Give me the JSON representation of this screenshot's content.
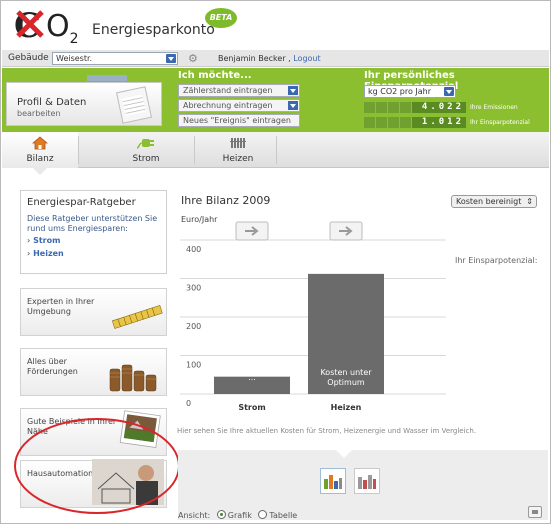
{
  "logo": {
    "brand_text": "Energiesparkonto",
    "badge": "BETA"
  },
  "topbar": {
    "gebaeude_label": "Gebäude",
    "gebaeude_value": "Weisestr.",
    "user_name": "Benjamin Becker ,",
    "logout": "Logout"
  },
  "profile": {
    "title": "Profil & Daten",
    "subtitle": "bearbeiten"
  },
  "actions": {
    "title": "Ich möchte...",
    "zaehlerstand": "Zählerstand eintragen",
    "abrechnung": "Abrechnung eintragen",
    "ereignis": "Neues \"Ereignis\" eintragen"
  },
  "potential": {
    "title": "Ihr persönliches Einsparpotenzial",
    "unit_select": "kg CO2 pro Jahr",
    "emissions_value": "4.022",
    "emissions_label": "Ihre Emissionen",
    "savings_value": "1.012",
    "savings_label": "Ihr Einsparpotenzial"
  },
  "nav": {
    "tabs": [
      {
        "label": "Bilanz"
      },
      {
        "label": "Strom"
      },
      {
        "label": "Heizen"
      }
    ]
  },
  "ratgeber": {
    "title": "Energiespar-Ratgeber",
    "desc": "Diese Ratgeber unterstützen Sie rund ums Energiesparen:",
    "links": [
      "Strom",
      "Heizen"
    ]
  },
  "tiles": [
    {
      "label": "Experten in Ihrer Umgebung"
    },
    {
      "label": "Alles über Förderungen"
    },
    {
      "label": "Gute Beispiele in Ihrer Nähe"
    },
    {
      "label": "Hausautomation"
    }
  ],
  "content": {
    "title": "Ihre Bilanz 2009",
    "cost_select": "Kosten bereinigt",
    "unit": "Euro/Jahr",
    "sparpotenzial": "Ihr Einsparpotenzial:",
    "note": "Hier sehen Sie Ihre aktuellen Kosten für Strom, Heizenergie und Wasser im Vergleich."
  },
  "chart_data": {
    "type": "bar",
    "ylabel": "Euro/Jahr",
    "ylim": [
      0,
      400
    ],
    "yticks": [
      0,
      100,
      200,
      300,
      400
    ],
    "grid": true,
    "categories": [
      "Strom",
      "Heizen"
    ],
    "values": [
      45,
      312
    ],
    "bar_labels": [
      "...",
      "Kosten unter Optimum"
    ],
    "bar_color": "#6b6b6b"
  },
  "view": {
    "ansicht_label": "Ansicht:",
    "option_grafik": "Grafik",
    "option_tabelle": "Tabelle"
  },
  "colors": {
    "green": "#8cbf2f",
    "accent_blue": "#3b68b0",
    "highlight_red": "#d9262a"
  }
}
